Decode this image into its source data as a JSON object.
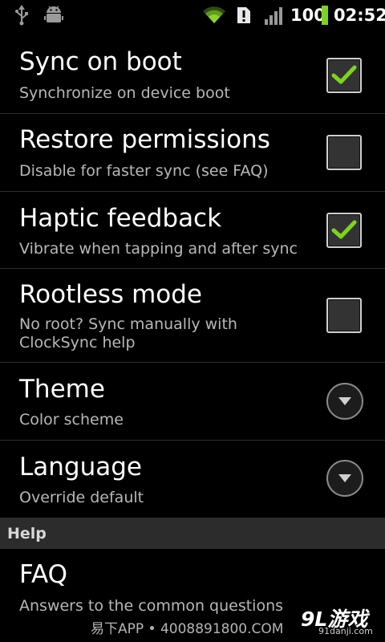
{
  "status_bar": {
    "battery_level": "100",
    "time": "02:52",
    "icons": [
      "usb-icon",
      "android-debug-icon",
      "wifi-icon",
      "alert-icon",
      "signal-icon",
      "battery-icon"
    ]
  },
  "preferences": [
    {
      "title": "Sync on boot",
      "summary": "Synchronize on device boot",
      "widget": "checkbox",
      "checked": true
    },
    {
      "title": "Restore permissions",
      "summary": "Disable for faster sync (see FAQ)",
      "widget": "checkbox",
      "checked": false
    },
    {
      "title": "Haptic feedback",
      "summary": "Vibrate when tapping and after sync",
      "widget": "checkbox",
      "checked": true
    },
    {
      "title": "Rootless mode",
      "summary": "No root? Sync manually with ClockSync help",
      "widget": "checkbox",
      "checked": false
    },
    {
      "title": "Theme",
      "summary": "Color scheme",
      "widget": "dropdown"
    },
    {
      "title": "Language",
      "summary": "Override default",
      "widget": "dropdown"
    }
  ],
  "help_section": {
    "category": "Help",
    "items": [
      {
        "title": "FAQ",
        "summary": "Answers to the common questions"
      }
    ]
  },
  "watermark": {
    "text": "易下APP • 4008891800.COM",
    "logo": "9L游戏",
    "logo_sub": "91danji.com"
  },
  "colors": {
    "background": "#000000",
    "check_green": "#7ed321",
    "category_bg": "#2c2c2c",
    "summary_text": "#b8b8b8"
  }
}
